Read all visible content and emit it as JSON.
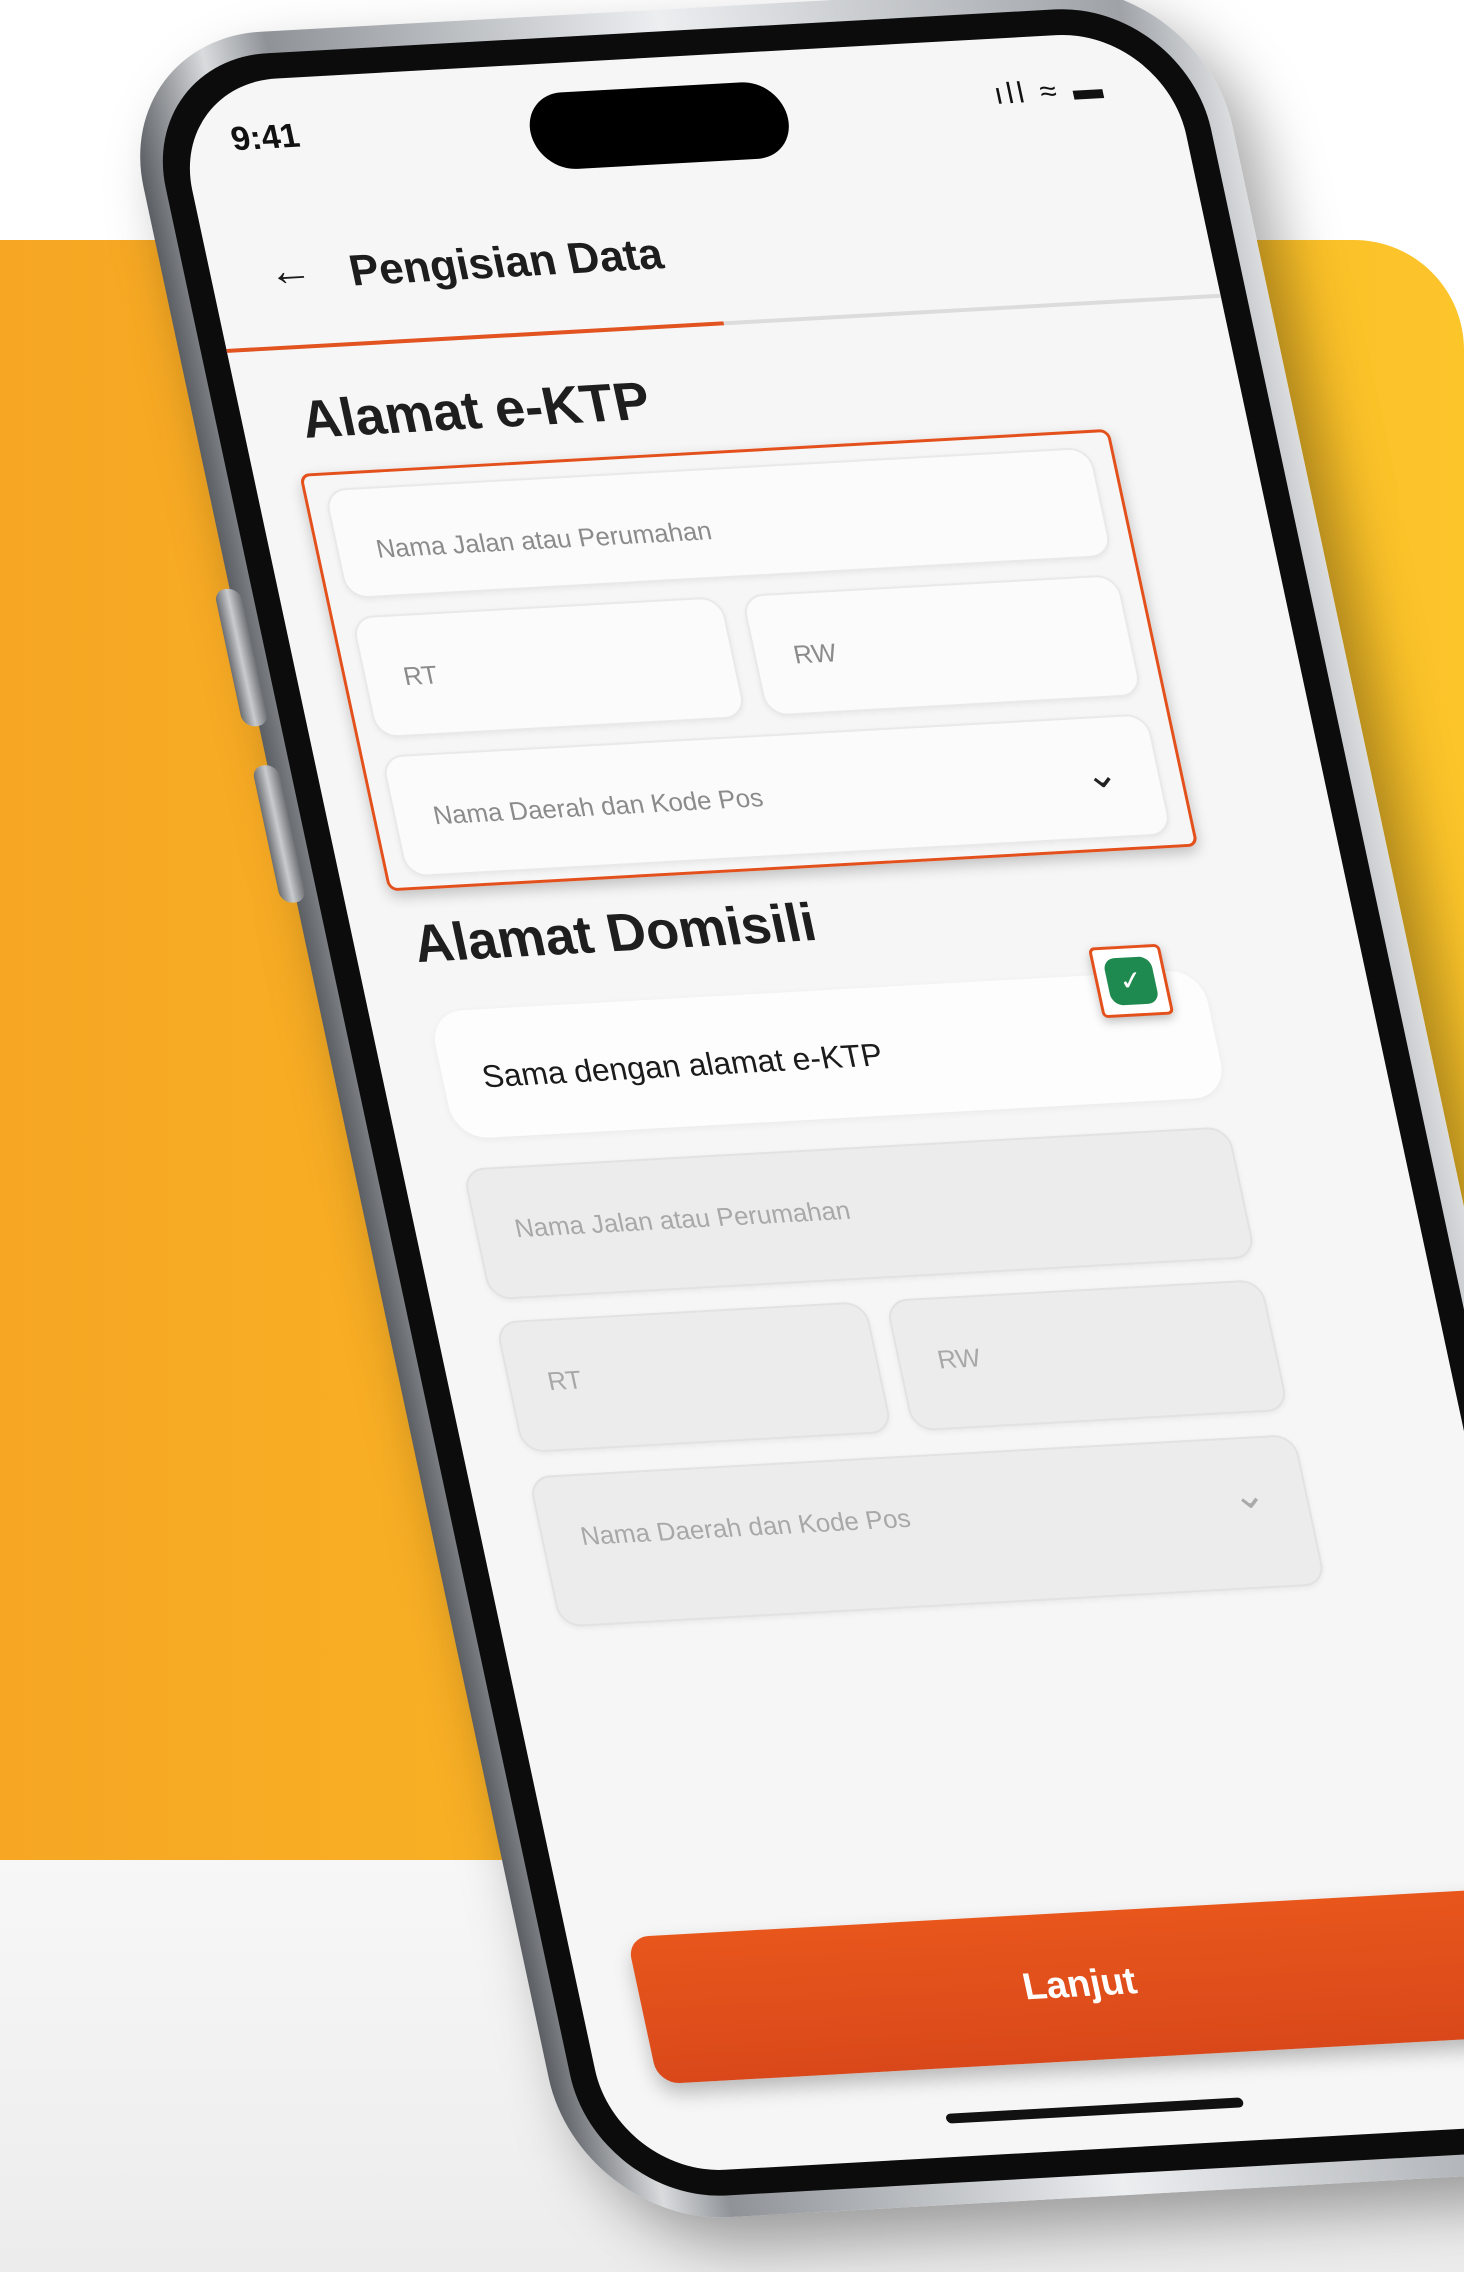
{
  "status_bar": {
    "time": "9:41",
    "icons": "ıll ≈ ▬"
  },
  "header": {
    "back_icon": "←",
    "title": "Pengisian Data",
    "progress": 0.5
  },
  "alamat_ektp": {
    "title": "Alamat e-KTP",
    "street_placeholder": "Nama Jalan atau Perumahan",
    "rt_placeholder": "RT",
    "rw_placeholder": "RW",
    "region_placeholder": "Nama Daerah dan Kode Pos",
    "chevron": "⌄"
  },
  "alamat_domisili": {
    "title": "Alamat Domisili",
    "same_label": "Sama dengan alamat e-KTP",
    "same_checked": true,
    "check_glyph": "✓",
    "street_placeholder": "Nama Jalan atau Perumahan",
    "rt_placeholder": "RT",
    "rw_placeholder": "RW",
    "region_placeholder": "Nama Daerah dan Kode Pos",
    "chevron": "⌄"
  },
  "cta": {
    "label": "Lanjut"
  },
  "colors": {
    "accent": "#e4501c",
    "background_yellow": "#f6a623",
    "check_green": "#1f8a4f"
  }
}
